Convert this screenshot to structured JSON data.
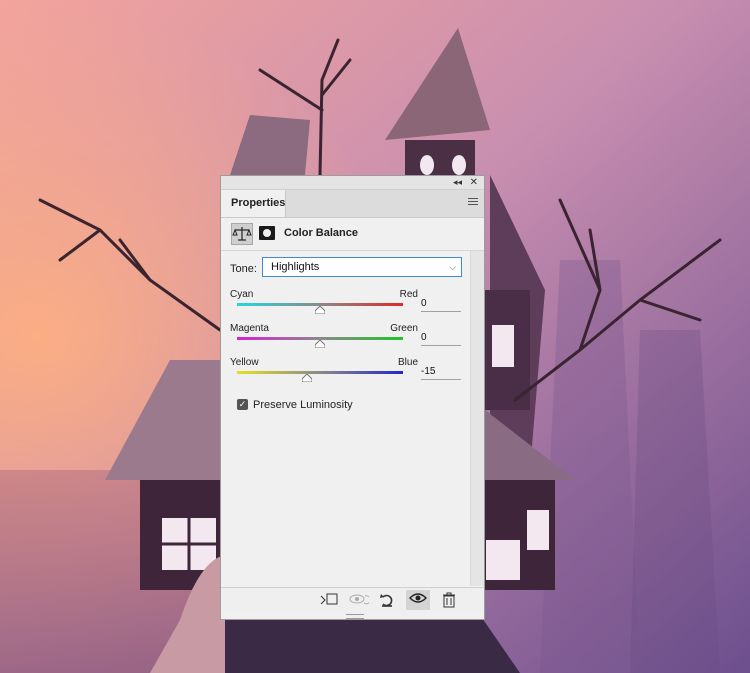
{
  "panel": {
    "tab_label": "Properties",
    "adjustment_title": "Color Balance",
    "tone": {
      "label": "Tone:",
      "value": "Highlights"
    },
    "sliders": [
      {
        "left_label": "Cyan",
        "right_label": "Red",
        "value": "0"
      },
      {
        "left_label": "Magenta",
        "right_label": "Green",
        "value": "0"
      },
      {
        "left_label": "Yellow",
        "right_label": "Blue",
        "value": "-15"
      }
    ],
    "preserve_luminosity": {
      "label": "Preserve Luminosity",
      "checked": true
    },
    "bottom_icons": [
      "clip-to-layer-icon",
      "view-previous-state-icon",
      "reset-icon",
      "toggle-visibility-icon",
      "trash-icon"
    ]
  },
  "colors": {
    "panel_bg": "#f0f0f0",
    "accent": "#3f8ad8"
  }
}
